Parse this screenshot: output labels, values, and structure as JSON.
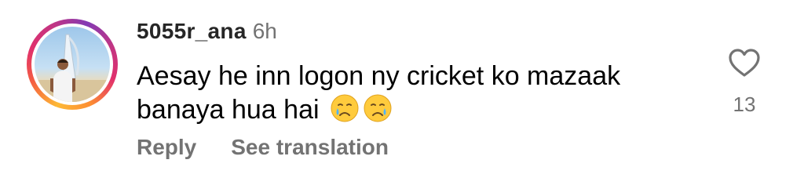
{
  "comment": {
    "username": "5055r_ana",
    "time": "6h",
    "text": "Aesay he inn logon ny cricket ko mazaak banaya hua hai",
    "emojis": [
      "crying-face",
      "crying-face"
    ],
    "like_count": "13"
  },
  "actions": {
    "reply_label": "Reply",
    "translate_label": "See translation"
  },
  "colors": {
    "username": "#262626",
    "secondary": "#737373",
    "story_ring_start": "#fdb936",
    "story_ring_end": "#833ab4"
  },
  "icons": {
    "like": "heart-outline-icon",
    "emoji": "crying-face-emoji"
  }
}
